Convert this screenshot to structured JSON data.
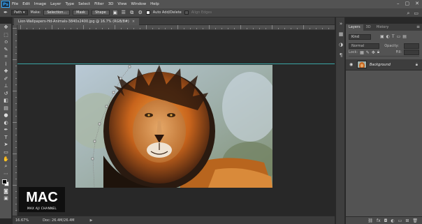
{
  "app": {
    "logo": "Ps",
    "menu": [
      "File",
      "Edit",
      "Image",
      "Layer",
      "Type",
      "Select",
      "Filter",
      "3D",
      "View",
      "Window",
      "Help"
    ],
    "window_controls": [
      "minimize-icon",
      "maximize-icon",
      "close-icon"
    ]
  },
  "options_bar": {
    "mode_select": "Path",
    "make_label": "Make:",
    "selection_button": "Selection...",
    "mask_button": "Mask",
    "shape_button": "Shape",
    "auto_add_delete_label": "Auto Add/Delete",
    "align_edges_label": "Align Edges"
  },
  "document": {
    "tab_title": "Lion-Wallpapers-Hd-Animals-3840x2400.jpg @ 16.7% (RGB/8#)",
    "close_glyph": "×"
  },
  "status": {
    "zoom": "16.67%",
    "doc_size": "Doc: 26.4M/26.4M"
  },
  "layers_panel": {
    "tabs": [
      "Layers",
      "3D",
      "History"
    ],
    "filter_kind": "Kind",
    "blend_mode": "Normal",
    "opacity_label": "Opacity:",
    "lock_label": "Lock:",
    "fill_label": "Fill:",
    "layers": [
      {
        "name": "Background",
        "visible": true,
        "locked": true
      }
    ]
  },
  "watermark": {
    "logo": "MAC",
    "caption": "MAX AJI CHANNEL"
  },
  "colors": {
    "foreground": "#000000",
    "background": "#ffffff",
    "guide": "#3fc6c6"
  }
}
